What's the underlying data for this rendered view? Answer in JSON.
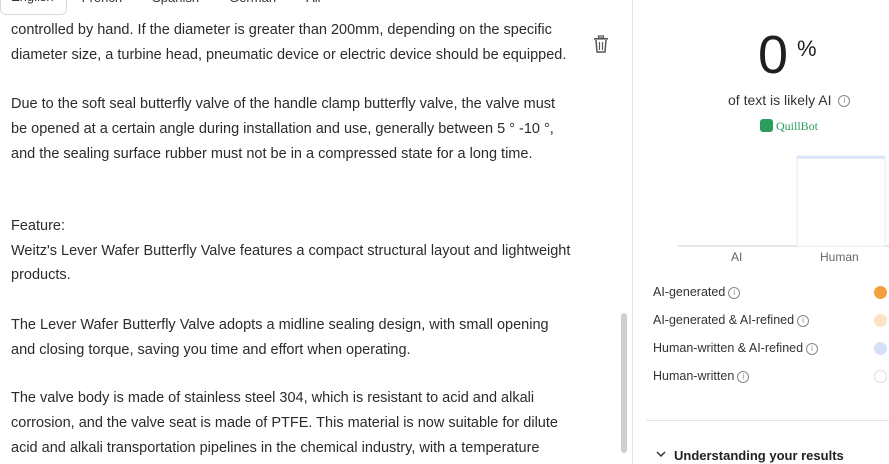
{
  "tabs": [
    "English",
    "French",
    "Spanish",
    "German",
    "All"
  ],
  "editor": {
    "lines": [
      "controlled by hand. If the diameter is greater than 200mm, depending on the specific",
      "diameter size, a turbine head, pneumatic device or electric device should be equipped.",
      "Due to the soft seal butterfly valve of the handle clamp butterfly valve, the valve must",
      "be opened at a certain angle during installation and use, generally between 5 ° -10 °,",
      "and the sealing surface rubber must not be in a compressed state for a long time.",
      "Feature:",
      "Weitz's Lever Wafer Butterfly Valve features a compact structural layout and lightweight",
      "products.",
      "The Lever Wafer Butterfly Valve adopts a midline sealing design, with small opening",
      "and closing torque, saving you time and effort when operating.",
      "The valve body is made of stainless steel 304, which is resistant to acid and alkali",
      "corrosion, and the valve seat is made of PTFE. This material is now suitable for dilute",
      "acid and alkali transportation pipelines in the chemical industry, with a temperature"
    ]
  },
  "result": {
    "score": "0",
    "score_unit": "%",
    "likely_label": "of text is likely AI",
    "brand": "QuillBot"
  },
  "chart_data": {
    "type": "bar",
    "categories": [
      "AI",
      "Human"
    ],
    "values": [
      0,
      100
    ],
    "ylim": [
      0,
      100
    ],
    "colors": [
      "#f4a040",
      "#dbe6f7"
    ]
  },
  "legend": [
    {
      "label": "AI-generated",
      "color": "#f4a040"
    },
    {
      "label": "AI-generated & AI-refined",
      "color": "#fbe3c4"
    },
    {
      "label": "Human-written & AI-refined",
      "color": "#d5e1f7"
    },
    {
      "label": "Human-written",
      "color": "#ffffff"
    }
  ],
  "understanding_label": "Understanding your results"
}
